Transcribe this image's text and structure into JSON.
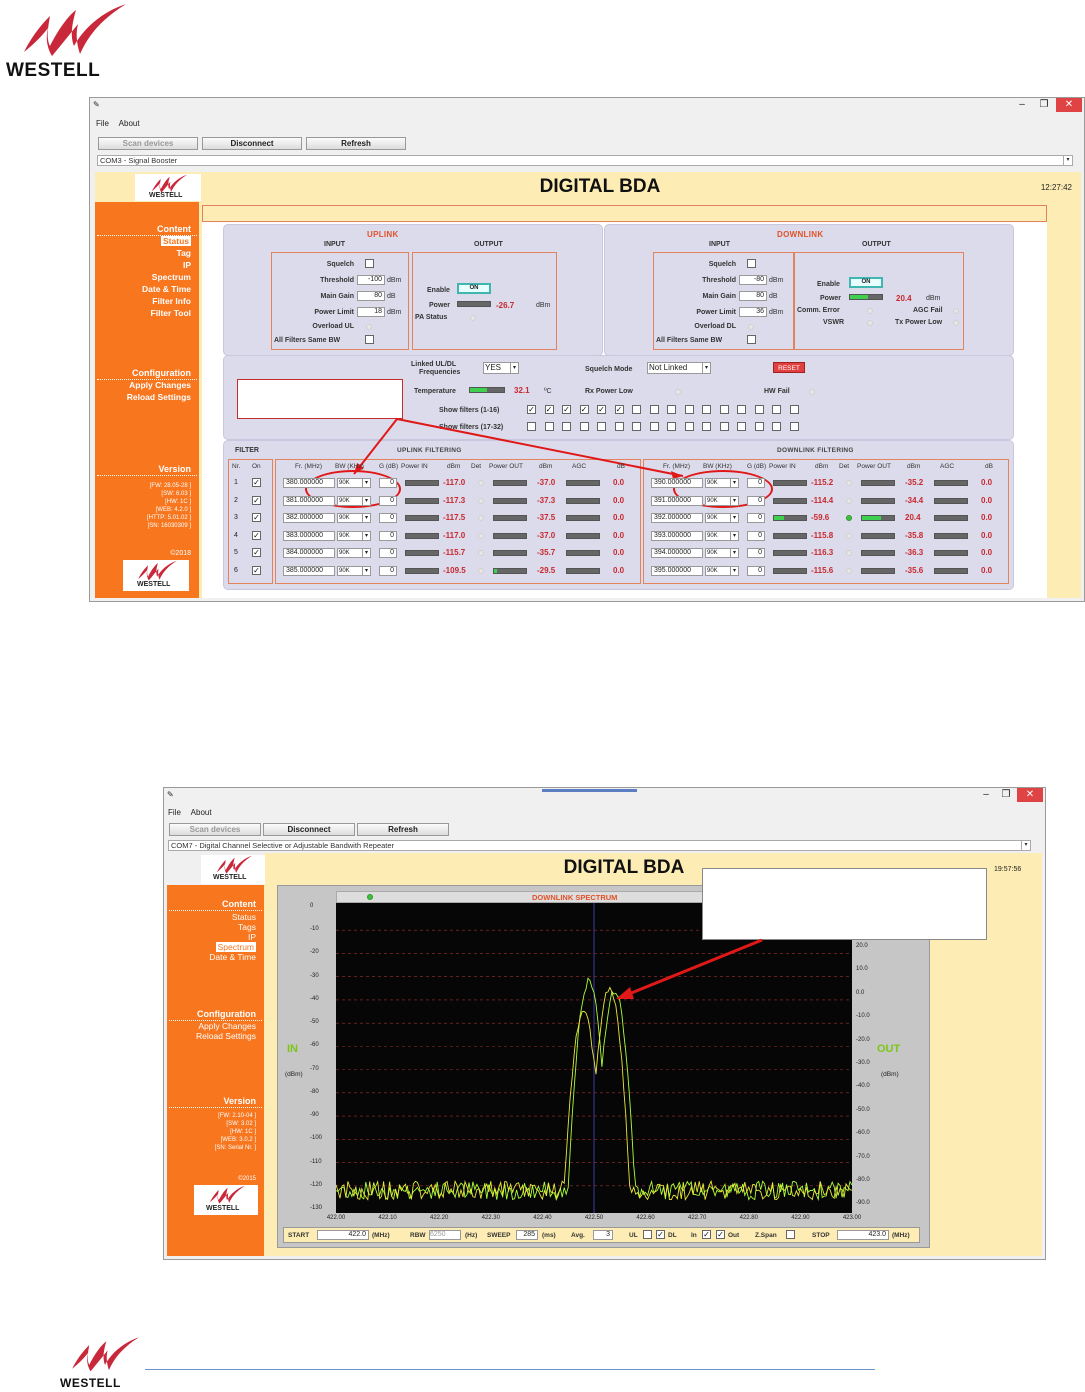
{
  "brand": {
    "name": "WESTELL"
  },
  "window1": {
    "menu": [
      "File",
      "About"
    ],
    "toolbar": {
      "scan": "Scan devices",
      "disconnect": "Disconnect",
      "refresh": "Refresh"
    },
    "device": "COM3 - Signal Booster",
    "title": "DIGITAL BDA",
    "time": "12:27:42",
    "sidebar": {
      "content_heading": "Content",
      "content_items": [
        "Status",
        "Tag",
        "IP",
        "Spectrum",
        "Date & Time",
        "Filter Info",
        "Filter Tool"
      ],
      "selected": "Status",
      "config_heading": "Configuration",
      "config_items": [
        "Apply Changes",
        "Reload Settings"
      ],
      "version_heading": "Version",
      "version_lines": [
        "[FW: 28.05-28 ]",
        "[SW: 6.03 ]",
        "[HW:   1C ]",
        "[WEB: 4.2.0 ]",
        "[HTTP: 5.01.02 ]",
        "[SN: 16030309 ]"
      ],
      "copyright": "©2018"
    },
    "uplink": {
      "title": "UPLINK",
      "input_label": "INPUT",
      "output_label": "OUTPUT",
      "squelch": "Squelch",
      "threshold": "Threshold",
      "threshold_value": "-100",
      "threshold_unit": "dBm",
      "main_gain": "Main Gain",
      "main_gain_value": "80",
      "main_gain_unit": "dB",
      "power_limit": "Power Limit",
      "power_limit_value": "18",
      "power_limit_unit": "dBm",
      "overload": "Overload UL",
      "all_filters": "All Filters Same BW",
      "enable": "Enable",
      "enable_state": "ON",
      "power": "Power",
      "power_value": "-26.7",
      "power_unit": "dBm",
      "pa_status": "PA Status"
    },
    "downlink": {
      "title": "DOWNLINK",
      "input_label": "INPUT",
      "output_label": "OUTPUT",
      "squelch": "Squelch",
      "threshold": "Threshold",
      "threshold_value": "-80",
      "threshold_unit": "dBm",
      "main_gain": "Main Gain",
      "main_gain_value": "80",
      "main_gain_unit": "dB",
      "power_limit": "Power Limit",
      "power_limit_value": "36",
      "power_limit_unit": "dBm",
      "overload": "Overload DL",
      "all_filters": "All Filters Same BW",
      "enable": "Enable",
      "enable_state": "ON",
      "power": "Power",
      "power_value": "20.4",
      "power_unit": "dBm",
      "comm_error": "Comm. Error",
      "vswr": "VSWR",
      "agc_fail": "AGC Fail",
      "tx_power_low": "Tx Power Low"
    },
    "misc": {
      "linked": "Linked UL/DL",
      "frequencies": "Frequencies",
      "linked_value": "YES",
      "squelch_mode": "Squelch Mode",
      "squelch_mode_value": "Not Linked",
      "reset": "RESET",
      "temperature": "Temperature",
      "temperature_value": "32.1",
      "temperature_unit": "ºC",
      "rx_power_low": "Rx Power Low",
      "hw_fail": "HW Fail",
      "show_1_16": "Show filters (1-16)",
      "show_17_32": "Show filters (17-32)",
      "show_1_16_checked": 6
    },
    "filtering": {
      "filter_label": "FILTER",
      "nr": "Nr.",
      "on": "On",
      "ul_title": "UPLINK FILTERING",
      "dl_title": "DOWNLINK FILTERING",
      "col_freq": "Fr. (MHz)",
      "col_bw": "BW (KHz)",
      "col_g": "G (dB)",
      "col_pin": "Power IN",
      "col_dbm": "dBm",
      "col_det": "Det",
      "col_pout": "Power OUT",
      "col_dbm2": "dBm",
      "col_agc": "AGC",
      "col_db": "dB",
      "rows": [
        {
          "nr": "1",
          "ul_freq": "380.000000",
          "ul_bw": "90K",
          "ul_g": "0",
          "ul_in": "-117.0",
          "ul_out": "-37.0",
          "ul_agc": "0.0",
          "dl_freq": "390.000000",
          "dl_bw": "90K",
          "dl_g": "0",
          "dl_in": "-115.2",
          "dl_out": "-35.2",
          "dl_agc": "0.0"
        },
        {
          "nr": "2",
          "ul_freq": "381.000000",
          "ul_bw": "90K",
          "ul_g": "0",
          "ul_in": "-117.3",
          "ul_out": "-37.3",
          "ul_agc": "0.0",
          "dl_freq": "391.000000",
          "dl_bw": "90K",
          "dl_g": "0",
          "dl_in": "-114.4",
          "dl_out": "-34.4",
          "dl_agc": "0.0"
        },
        {
          "nr": "3",
          "ul_freq": "382.000000",
          "ul_bw": "90K",
          "ul_g": "0",
          "ul_in": "-117.5",
          "ul_out": "-37.5",
          "ul_agc": "0.0",
          "dl_freq": "392.000000",
          "dl_bw": "90K",
          "dl_g": "0",
          "dl_in": "-59.6",
          "dl_out": "20.4",
          "dl_agc": "0.0"
        },
        {
          "nr": "4",
          "ul_freq": "383.000000",
          "ul_bw": "90K",
          "ul_g": "0",
          "ul_in": "-117.0",
          "ul_out": "-37.0",
          "ul_agc": "0.0",
          "dl_freq": "393.000000",
          "dl_bw": "90K",
          "dl_g": "0",
          "dl_in": "-115.8",
          "dl_out": "-35.8",
          "dl_agc": "0.0"
        },
        {
          "nr": "5",
          "ul_freq": "384.000000",
          "ul_bw": "90K",
          "ul_g": "0",
          "ul_in": "-115.7",
          "ul_out": "-35.7",
          "ul_agc": "0.0",
          "dl_freq": "394.000000",
          "dl_bw": "90K",
          "dl_g": "0",
          "dl_in": "-116.3",
          "dl_out": "-36.3",
          "dl_agc": "0.0"
        },
        {
          "nr": "6",
          "ul_freq": "385.000000",
          "ul_bw": "90K",
          "ul_g": "0",
          "ul_in": "-109.5",
          "ul_out": "-29.5",
          "ul_agc": "0.0",
          "dl_freq": "395.000000",
          "dl_bw": "90K",
          "dl_g": "0",
          "dl_in": "-115.6",
          "dl_out": "-35.6",
          "dl_agc": "0.0"
        }
      ]
    }
  },
  "window2": {
    "menu": [
      "File",
      "About"
    ],
    "toolbar": {
      "scan": "Scan devices",
      "disconnect": "Disconnect",
      "refresh": "Refresh"
    },
    "device": "COM7 - Digital Channel Selective or Adjustable Bandwith Repeater",
    "title": "DIGITAL BDA",
    "time": "19:57:56",
    "sidebar": {
      "content_heading": "Content",
      "content_items": [
        "Status",
        "Tags",
        "IP",
        "Spectrum",
        "Date & Time"
      ],
      "selected": "Spectrum",
      "config_heading": "Configuration",
      "config_items": [
        "Apply Changes",
        "Reload Settings"
      ],
      "version_heading": "Version",
      "version_lines": [
        "[FW: 2.10-04 ]",
        "[SW: 3.02 ]",
        "[HW:   1C ]",
        "[WEB: 3.0.2 ]",
        "[SN: Serial Nr. ]"
      ],
      "copyright": "©2015"
    },
    "spectrum": {
      "title": "DOWNLINK SPECTRUM",
      "in_label": "IN",
      "out_label": "OUT",
      "in_unit": "(dBm)",
      "out_unit": "(dBm)",
      "start_label": "START",
      "start_value": "422.0",
      "start_unit": "(MHz)",
      "rbw_label": "RBW",
      "rbw_value": "6250",
      "rbw_unit": "(Hz)",
      "sweep_label": "SWEEP",
      "sweep_value": "285",
      "sweep_unit": "(ms)",
      "avg_label": "Avg.",
      "avg_value": "3",
      "ul_label": "UL",
      "dl_label": "DL",
      "in_chk": "In",
      "out_chk": "Out",
      "zspan_label": "Z.Span",
      "stop_label": "STOP",
      "stop_value": "423.0",
      "stop_unit": "(MHz)"
    }
  },
  "chart_data": {
    "type": "line",
    "title": "DOWNLINK SPECTRUM",
    "x_ticks": [
      "422.00",
      "422.10",
      "422.20",
      "422.30",
      "422.40",
      "422.50",
      "422.60",
      "422.70",
      "422.80",
      "422.90",
      "423.00"
    ],
    "y_left_ticks": [
      "0",
      "-10",
      "-20",
      "-30",
      "-40",
      "-50",
      "-60",
      "-70",
      "-80",
      "-90",
      "-100",
      "-110",
      "-120",
      "-130"
    ],
    "y_right_ticks": [
      "20.0",
      "10.0",
      "0.0",
      "-10.0",
      "-20.0",
      "-30.0",
      "-40.0",
      "-50.0",
      "-60.0",
      "-70.0",
      "-80.0",
      "-90.0"
    ],
    "xlim": [
      422.0,
      423.0
    ],
    "ylim_in": [
      -130,
      0
    ],
    "series": [
      {
        "name": "IN",
        "color": "#a8ff3a",
        "peaks_dbm_at_mhz": [
          [
            422.49,
            -32
          ],
          [
            422.54,
            -36
          ]
        ]
      },
      {
        "name": "OUT",
        "color": "#e8e83a",
        "peaks_dbm_at_mhz": [
          [
            422.48,
            -45
          ],
          [
            422.53,
            -35
          ]
        ]
      }
    ]
  }
}
